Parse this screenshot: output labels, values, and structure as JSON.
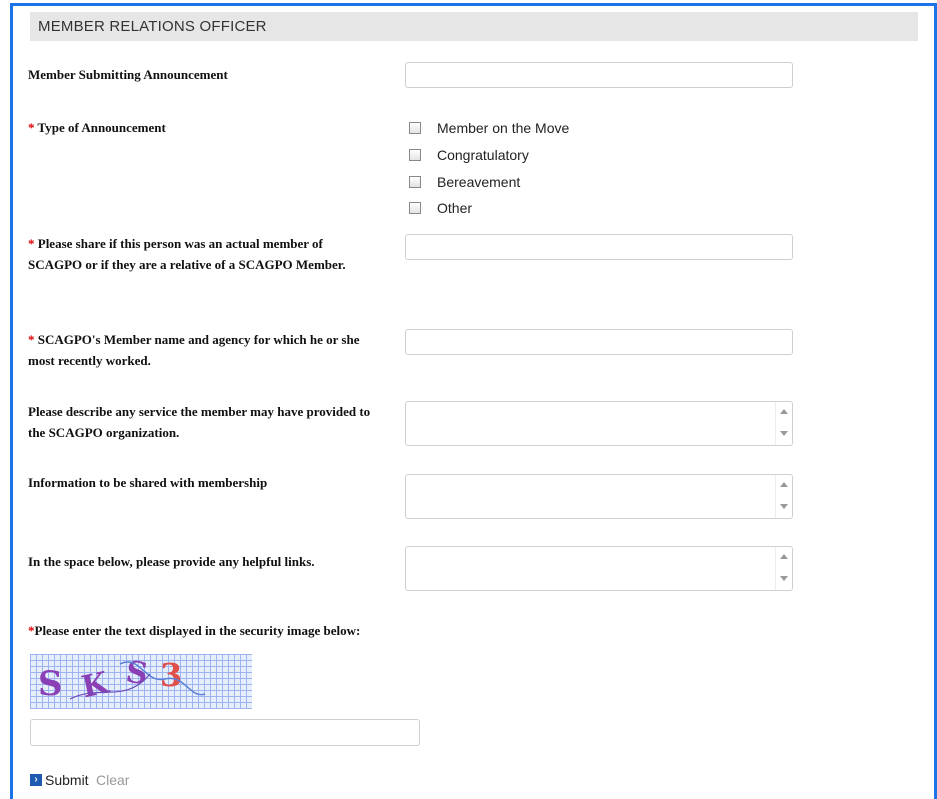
{
  "section": {
    "title": "MEMBER RELATIONS OFFICER"
  },
  "fields": {
    "member_submitting": {
      "label": "Member Submitting Announcement",
      "value": ""
    },
    "type": {
      "required_mark": "*",
      "label": "Type of Announcement",
      "options": [
        "Member on the Move",
        "Congratulatory",
        "Bereavement",
        "Other"
      ]
    },
    "actual_member": {
      "required_mark": "*",
      "label": "Please share if this person was an actual member of SCAGPO or if they are a relative of a SCAGPO Member.",
      "value": ""
    },
    "member_name_agency": {
      "required_mark": "*",
      "label": "SCAGPO's Member name and agency for which he or she most recently worked.",
      "value": ""
    },
    "service": {
      "label": "Please describe any service the member may have provided to the SCAGPO organization.",
      "value": ""
    },
    "info_shared": {
      "label": "Information to be shared with membership",
      "value": ""
    },
    "helpful_links": {
      "label": "In the space below, please provide any helpful links.",
      "value": ""
    }
  },
  "captcha": {
    "required_mark": "*",
    "label": "Please enter the text displayed in the security image below:",
    "image_text": "SKS3",
    "value": ""
  },
  "actions": {
    "submit_label": "Submit",
    "clear_label": "Clear"
  },
  "colors": {
    "accent": "#1a73e8",
    "required": "#dd0000",
    "header_bg": "#e6e6e6"
  }
}
